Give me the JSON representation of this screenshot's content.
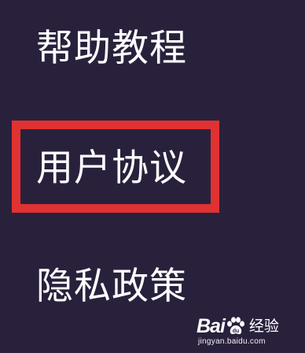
{
  "menu": {
    "items": [
      {
        "label": "帮助教程"
      },
      {
        "label": "用户协议",
        "highlighted": true
      },
      {
        "label": "隐私政策"
      }
    ]
  },
  "watermark": {
    "brand_left": "Bai",
    "brand_right": "经验",
    "url": "jingyan.baidu.com",
    "icon": "baidu-paw-icon"
  },
  "colors": {
    "background": "#29213c",
    "text": "#ffffff",
    "highlight_border": "#e03232"
  }
}
